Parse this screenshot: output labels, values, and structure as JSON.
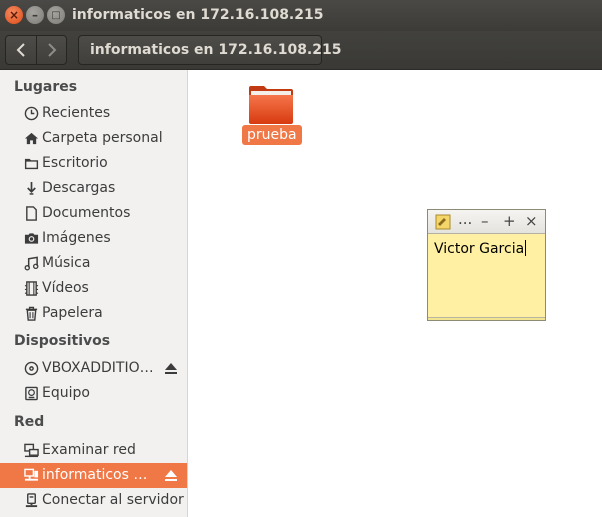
{
  "window": {
    "title": "informaticos en 172.16.108.215",
    "close_glyph": "×",
    "minimize_glyph": "–",
    "maximize_glyph": "□"
  },
  "toolbar": {
    "back_icon": "chevron-left-icon",
    "forward_icon": "chevron-right-icon",
    "path_label": "informaticos en 172.16.108.215"
  },
  "sidebar": {
    "sections": [
      {
        "header": "Lugares"
      },
      {
        "header": "Dispositivos"
      },
      {
        "header": "Red"
      }
    ],
    "places": [
      {
        "label": "Recientes",
        "icon": "clock-icon"
      },
      {
        "label": "Carpeta personal",
        "icon": "home-icon"
      },
      {
        "label": "Escritorio",
        "icon": "folder-icon"
      },
      {
        "label": "Descargas",
        "icon": "download-icon"
      },
      {
        "label": "Documentos",
        "icon": "document-icon"
      },
      {
        "label": "Imágenes",
        "icon": "camera-icon"
      },
      {
        "label": "Música",
        "icon": "music-icon"
      },
      {
        "label": "Vídeos",
        "icon": "film-icon"
      },
      {
        "label": "Papelera",
        "icon": "trash-icon"
      }
    ],
    "devices": [
      {
        "label": "VBOXADDITIO…",
        "icon": "disc-icon",
        "ejectable": true
      },
      {
        "label": "Equipo",
        "icon": "harddrive-icon"
      }
    ],
    "network": [
      {
        "label": "Examinar red",
        "icon": "network-icon"
      },
      {
        "label": "informaticos …",
        "icon": "network-share-icon",
        "ejectable": true,
        "selected": true
      },
      {
        "label": "Conectar al servidor",
        "icon": "server-icon"
      }
    ]
  },
  "main": {
    "items": [
      {
        "name": "prueba",
        "type": "folder",
        "selected": true
      }
    ]
  },
  "sticky_note": {
    "menu_label": "...",
    "minimize_label": "–",
    "add_label": "+",
    "close_label": "×",
    "text": "Victor Garcia"
  },
  "colors": {
    "accent": "#f07746",
    "titlebar": "#3c3b37",
    "note_bg": "#fff0a3"
  }
}
